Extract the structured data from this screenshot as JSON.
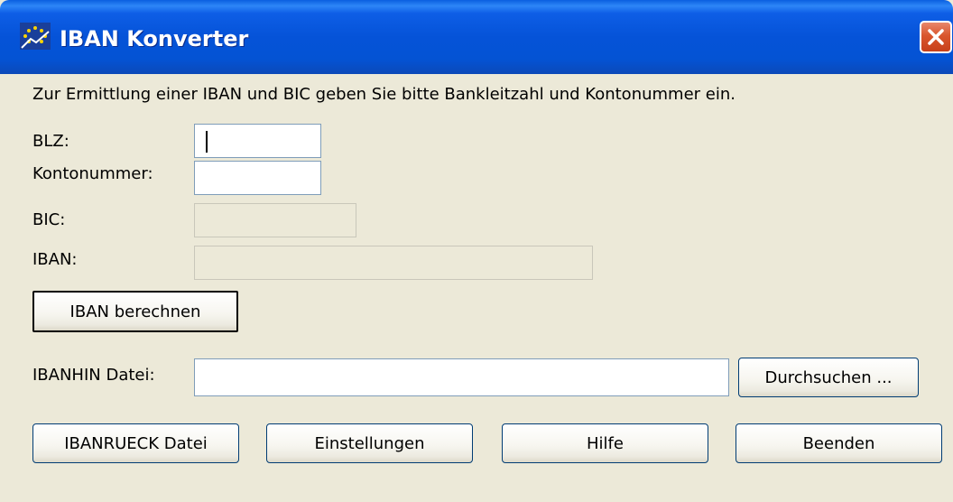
{
  "window": {
    "title": "IBAN Konverter",
    "icon": "app-icon",
    "close_icon": "close-icon"
  },
  "instructions": "Zur Ermittlung einer IBAN und BIC geben Sie bitte Bankleitzahl und Kontonummer ein.",
  "fields": {
    "blz": {
      "label": "BLZ:",
      "value": ""
    },
    "kontonummer": {
      "label": "Kontonummer:",
      "value": ""
    },
    "bic": {
      "label": "BIC:",
      "value": ""
    },
    "iban": {
      "label": "IBAN:",
      "value": ""
    },
    "ibanhin": {
      "label": "IBANHIN Datei:",
      "value": ""
    }
  },
  "buttons": {
    "calculate": "IBAN berechnen",
    "browse": "Durchsuchen ...",
    "ibanrueck": "IBANRUECK Datei",
    "settings": "Einstellungen",
    "help": "Hilfe",
    "exit": "Beenden"
  },
  "colors": {
    "titlebar": "#0553d8",
    "window_bg": "#ece9d8",
    "close_button": "#d9562d",
    "input_border": "#7f9db9"
  }
}
